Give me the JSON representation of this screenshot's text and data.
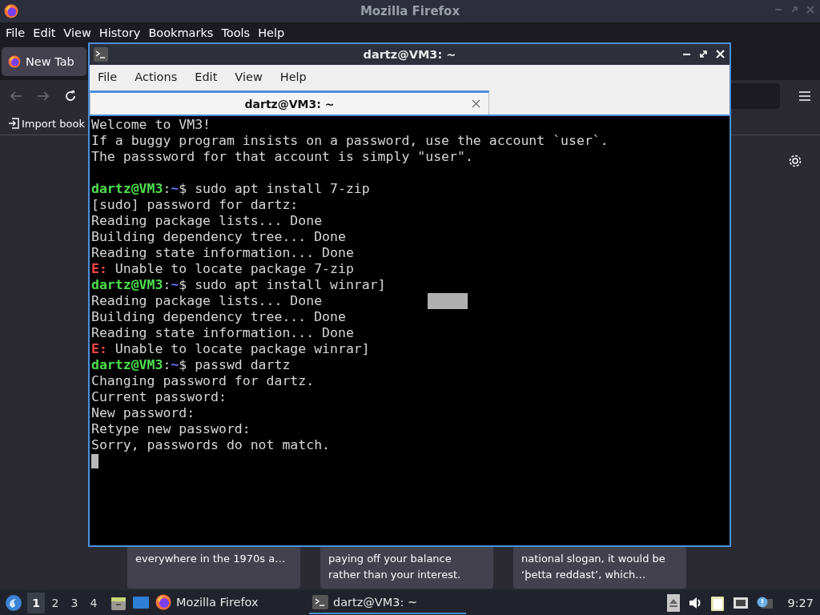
{
  "firefox": {
    "title": "Mozilla Firefox",
    "menu": [
      "File",
      "Edit",
      "View",
      "History",
      "Bookmarks",
      "Tools",
      "Help"
    ],
    "tabs": [
      {
        "label": "New Tab",
        "selected": true
      }
    ],
    "bookmarks": [
      "Import book"
    ],
    "cards": [
      {
        "lines": [
          "everywhere in the 1970s a…"
        ]
      },
      {
        "lines": [
          "paying off your balance",
          "rather than your interest."
        ]
      },
      {
        "lines": [
          "national slogan, it would be",
          "‘þetta reddast’, which…"
        ]
      }
    ]
  },
  "terminal": {
    "title": "dartz@VM3: ~",
    "menu": [
      "File",
      "Actions",
      "Edit",
      "View",
      "Help"
    ],
    "tabs": [
      {
        "label": "dartz@VM3: ~",
        "selected": true
      }
    ],
    "lines": [
      {
        "kind": "output",
        "segments": [
          {
            "kind": "plain",
            "text": "Welcome to VM3!"
          }
        ]
      },
      {
        "kind": "output",
        "segments": [
          {
            "kind": "plain",
            "text": "If a buggy program insists on a password, use the account `user`."
          }
        ]
      },
      {
        "kind": "output",
        "segments": [
          {
            "kind": "plain",
            "text": "The passsword for that account is simply \"user\"."
          }
        ]
      },
      {
        "kind": "blank"
      },
      {
        "kind": "output",
        "segments": [
          {
            "kind": "user",
            "text": "dartz@VM3"
          },
          {
            "kind": "plain",
            "text": ":"
          },
          {
            "kind": "path",
            "text": "~"
          },
          {
            "kind": "plain",
            "text": "$ sudo apt install 7-zip"
          }
        ]
      },
      {
        "kind": "output",
        "segments": [
          {
            "kind": "plain",
            "text": "[sudo] password for dartz:"
          }
        ]
      },
      {
        "kind": "output",
        "segments": [
          {
            "kind": "plain",
            "text": "Reading package lists... Done"
          }
        ]
      },
      {
        "kind": "output",
        "segments": [
          {
            "kind": "plain",
            "text": "Building dependency tree... Done"
          }
        ]
      },
      {
        "kind": "output",
        "segments": [
          {
            "kind": "plain",
            "text": "Reading state information... Done"
          }
        ]
      },
      {
        "kind": "output",
        "segments": [
          {
            "kind": "error",
            "text": "E:"
          },
          {
            "kind": "plain",
            "text": " Unable to locate package 7-zip"
          }
        ]
      },
      {
        "kind": "output",
        "segments": [
          {
            "kind": "user",
            "text": "dartz@VM3"
          },
          {
            "kind": "plain",
            "text": ":"
          },
          {
            "kind": "path",
            "text": "~"
          },
          {
            "kind": "plain",
            "text": "$ sudo apt install winrar]"
          }
        ]
      },
      {
        "kind": "output",
        "segments": [
          {
            "kind": "plain",
            "text": "Reading package lists... Done"
          }
        ]
      },
      {
        "kind": "output",
        "segments": [
          {
            "kind": "plain",
            "text": "Building dependency tree... Done"
          }
        ]
      },
      {
        "kind": "output",
        "segments": [
          {
            "kind": "plain",
            "text": "Reading state information... Done"
          }
        ]
      },
      {
        "kind": "output",
        "segments": [
          {
            "kind": "error",
            "text": "E:"
          },
          {
            "kind": "plain",
            "text": " Unable to locate package winrar]"
          }
        ]
      },
      {
        "kind": "output",
        "segments": [
          {
            "kind": "user",
            "text": "dartz@VM3"
          },
          {
            "kind": "plain",
            "text": ":"
          },
          {
            "kind": "path",
            "text": "~"
          },
          {
            "kind": "plain",
            "text": "$ passwd dartz"
          }
        ]
      },
      {
        "kind": "output",
        "segments": [
          {
            "kind": "plain",
            "text": "Changing password for dartz."
          }
        ]
      },
      {
        "kind": "output",
        "segments": [
          {
            "kind": "plain",
            "text": "Current password:"
          }
        ]
      },
      {
        "kind": "output",
        "segments": [
          {
            "kind": "plain",
            "text": "New password:"
          }
        ]
      },
      {
        "kind": "output",
        "segments": [
          {
            "kind": "plain",
            "text": "Retype new password:"
          }
        ]
      },
      {
        "kind": "output",
        "segments": [
          {
            "kind": "plain",
            "text": "Sorry, passwords do not match."
          }
        ]
      },
      {
        "kind": "cursor"
      }
    ]
  },
  "taskbar": {
    "workspaces": [
      {
        "label": "1",
        "selected": true
      },
      {
        "label": "2",
        "selected": false
      },
      {
        "label": "3",
        "selected": false
      },
      {
        "label": "4",
        "selected": false
      }
    ],
    "tasks": [
      {
        "kind": "browser",
        "label": "Mozilla Firefox",
        "selected": false
      },
      {
        "kind": "terminal",
        "label": "dartz@VM3: ~",
        "selected": true
      }
    ],
    "clock": "9:27"
  }
}
